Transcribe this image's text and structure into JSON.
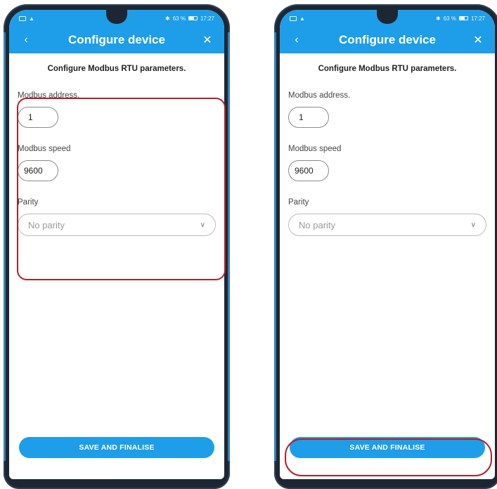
{
  "status": {
    "battery": "63 %",
    "time": "17:27"
  },
  "appbar": {
    "title": "Configure device",
    "back_icon": "‹",
    "close_icon": "✕"
  },
  "form": {
    "heading": "Configure Modbus RTU parameters.",
    "address_label": "Modbus address.",
    "address_value": "1",
    "speed_label": "Modbus speed",
    "speed_value": "9600",
    "parity_label": "Parity",
    "parity_value": "No parity"
  },
  "save_label": "SAVE AND FINALISE",
  "colors": {
    "accent": "#1e9ee8",
    "highlight": "#b3202a"
  }
}
